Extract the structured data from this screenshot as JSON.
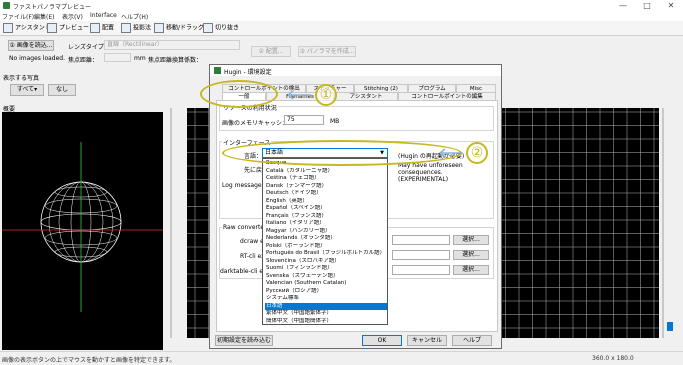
{
  "window": {
    "title": "ファストパノラマプレビュー",
    "controls": [
      "—",
      "□",
      "✕"
    ]
  },
  "menu": [
    "ファイル(F)",
    "編集(E)",
    "表示(V)",
    "Interface",
    "ヘルプ(H)"
  ],
  "toolbar": {
    "items": [
      "アシスタント",
      "プレビュー",
      "配置",
      "投影法",
      "移動/ドラッグ",
      "切り抜き"
    ],
    "load_images": "① 画像を読込...",
    "no_images": "No images loaded.",
    "lens_type_label": "レンズタイプ：",
    "lens_type_value": "直線（Rectilinear）",
    "focal_length_label": "焦点距離：",
    "focal_length_unit": "mm",
    "focal_multiplier_label": "焦点距離換算係数：",
    "align_button": "② 配置...",
    "create_panorama_button": "③ パノラマを作成..."
  },
  "show_images": {
    "label": "表示する写真",
    "all": "すべて▾",
    "none": "なし"
  },
  "left_panel": {
    "label": "概要"
  },
  "status": {
    "message": "画像の表示ボタンの上でマウスを動かすと画像を特定できます。",
    "coords": "360.0 x 180.0"
  },
  "dialog": {
    "title": "Hugin - 環境設定",
    "tabs_row1": [
      "コントロールポイントの検出",
      "ステッチャー",
      "Stitching (2)",
      "プログラム",
      "Misc"
    ],
    "tabs_row2": [
      "一般",
      "Filenames",
      "アシスタント",
      "コントロールポイントの編集"
    ],
    "resource_group": "リソースの利用状況",
    "cache_label": "画像のメモリキャッシュ：",
    "cache_value": "75",
    "cache_unit": "MB",
    "interface_group": "インターフェース",
    "language_label": "言語：",
    "language_value": "日本語",
    "language_note": "(Hugin の再起動が必要)",
    "copy_label": "先に戻す：",
    "copy_note": "May have unforeseen consequences. (EXPERIMENTAL)",
    "log_label": "Log messages:",
    "raw_group": "Raw converter",
    "raw_labels": [
      "dcraw exe",
      "RT-cli exe",
      "darktable-cli exe"
    ],
    "browse_button": "選択...",
    "load_defaults": "初期設定を読み込む",
    "ok": "OK",
    "cancel": "キャンセル",
    "help": "ヘルプ"
  },
  "language_options": [
    "Basque",
    "Català（カタルーニャ語）",
    "Čeština（チェコ語）",
    "Dansk（デンマーク語）",
    "Deutsch（ドイツ語）",
    "English（英語）",
    "Español（スペイン語）",
    "Français（フランス語）",
    "Italiano（イタリア語）",
    "Magyar（ハンガリー語）",
    "Nederlands（オランダ語）",
    "Polski（ポーランド語）",
    "Português do Brasil（ブラジルポルトガル語）",
    "Slovenčina（スロバキア語）",
    "Suomi（フィンランド語）",
    "Svenska（スウェーデン語）",
    "Valencian (Southern Catalan)",
    "Русский（ロシア語）",
    "システム標準",
    "日本語",
    "繁体中文（中国語繁体字）",
    "簡体中文（中国語簡体字）"
  ],
  "selected_language_index": 19,
  "annotations": {
    "first": "①",
    "second": "②"
  },
  "colors": {
    "selection": "#0078d7",
    "annotation": "#c6b821",
    "grid": "#b8b8b8",
    "sphere": "#ffffff"
  }
}
